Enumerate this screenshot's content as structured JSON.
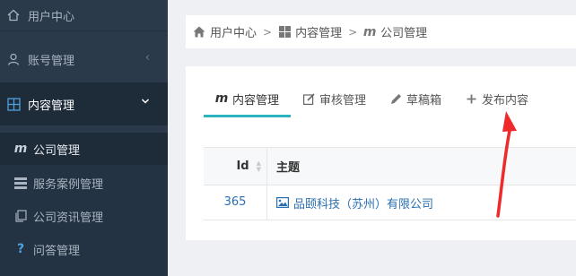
{
  "sidebar": {
    "items": [
      {
        "label": "用户中心",
        "icon": "home-icon"
      },
      {
        "label": "账号管理",
        "icon": "user-icon"
      },
      {
        "label": "内容管理",
        "icon": "grid-icon"
      }
    ],
    "submenu": [
      {
        "label": "公司管理",
        "icon": "m-icon"
      },
      {
        "label": "服务案例管理",
        "icon": "list-icon"
      },
      {
        "label": "公司资讯管理",
        "icon": "copy-icon"
      },
      {
        "label": "问答管理",
        "icon": "question-icon"
      }
    ]
  },
  "breadcrumb": [
    {
      "label": "用户中心",
      "icon": "home-icon"
    },
    {
      "label": "内容管理",
      "icon": "grid-icon"
    },
    {
      "label": "公司管理",
      "icon": "m-icon"
    }
  ],
  "tabs": [
    {
      "label": "内容管理",
      "icon": "m-icon"
    },
    {
      "label": "审核管理",
      "icon": "edit-icon"
    },
    {
      "label": "草稿箱",
      "icon": "pencil-icon"
    },
    {
      "label": "发布内容",
      "icon": "plus-icon"
    }
  ],
  "table": {
    "columns": [
      "Id",
      "主题"
    ],
    "rows": [
      {
        "id": "365",
        "subject": "品颐科技（苏州）有限公司"
      }
    ]
  },
  "colors": {
    "sidebar_bg": "#2a3a4b",
    "accent": "#2ab4c0",
    "link": "#2a6fb0",
    "annotation_arrow": "#ee2a2a"
  }
}
